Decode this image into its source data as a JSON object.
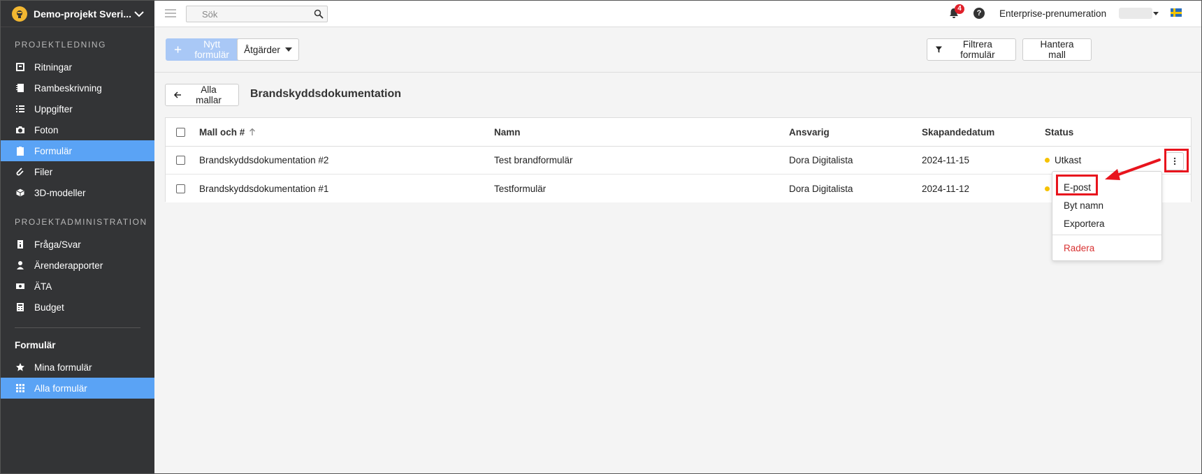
{
  "project": {
    "name": "Demo-projekt Sveri..."
  },
  "sidebar": {
    "sections": [
      {
        "title": "PROJEKTLEDNING",
        "items": [
          {
            "label": "Ritningar",
            "icon": "drawings-icon"
          },
          {
            "label": "Rambeskrivning",
            "icon": "notebook-icon"
          },
          {
            "label": "Uppgifter",
            "icon": "list-icon"
          },
          {
            "label": "Foton",
            "icon": "camera-icon"
          },
          {
            "label": "Formulär",
            "icon": "clipboard-icon",
            "active": true
          },
          {
            "label": "Filer",
            "icon": "paperclip-icon"
          },
          {
            "label": "3D-modeller",
            "icon": "cube-icon"
          }
        ]
      },
      {
        "title": "PROJEKTADMINISTRATION",
        "items": [
          {
            "label": "Fråga/Svar",
            "icon": "question-doc-icon"
          },
          {
            "label": "Ärenderapporter",
            "icon": "person-icon"
          },
          {
            "label": "ÄTA",
            "icon": "money-icon"
          },
          {
            "label": "Budget",
            "icon": "calculator-icon"
          }
        ]
      }
    ],
    "forms_heading": "Formulär",
    "forms_items": [
      {
        "label": "Mina formulär",
        "icon": "star-icon"
      },
      {
        "label": "Alla formulär",
        "icon": "grid-icon",
        "active": true
      }
    ]
  },
  "topbar": {
    "search_placeholder": "Sök",
    "notifications_count": "4",
    "help": "?",
    "plan": "Enterprise-prenumeration"
  },
  "toolbar": {
    "new_form": "Nytt formulär",
    "actions": "Åtgärder",
    "filter": "Filtrera formulär",
    "manage_template": "Hantera mall"
  },
  "page": {
    "back_label": "Alla mallar",
    "title": "Brandskyddsdokumentation"
  },
  "table": {
    "columns": [
      "Mall och #",
      "Namn",
      "Ansvarig",
      "Skapandedatum",
      "Status"
    ],
    "rows": [
      {
        "template": "Brandskyddsdokumentation #2",
        "name": "Test brandformulär",
        "responsible": "Dora Digitalista",
        "created": "2024-11-15",
        "status": "Utkast"
      },
      {
        "template": "Brandskyddsdokumentation #1",
        "name": "Testformulär",
        "responsible": "Dora Digitalista",
        "created": "2024-11-12",
        "status": ""
      }
    ]
  },
  "row_menu": {
    "items": [
      "E-post",
      "Byt namn",
      "Exportera"
    ],
    "danger_item": "Radera"
  },
  "colors": {
    "sidebar_bg": "#333436",
    "active_blue": "#5aa3f5",
    "primary_disabled": "#a9c8f6",
    "status_draft": "#f6c200",
    "danger": "#d83232",
    "annotation_red": "#e8141d"
  }
}
